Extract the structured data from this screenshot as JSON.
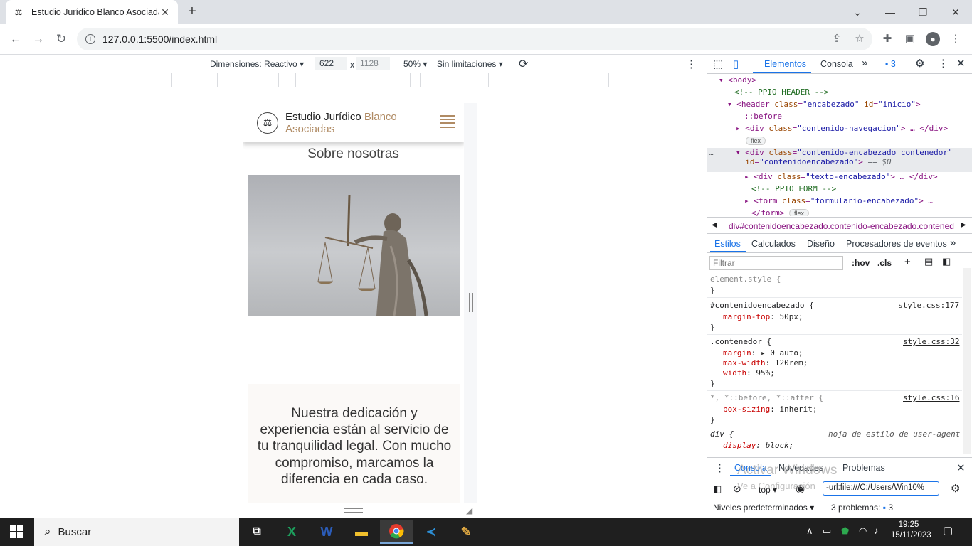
{
  "browser": {
    "tab_title": "Estudio Jurídico Blanco Asociadas",
    "favicon": "gavel-icon",
    "url": "127.0.0.1:5500/index.html"
  },
  "device_toolbar": {
    "dimensions_label": "Dimensiones: Reactivo",
    "width": "622",
    "x_sep": "x",
    "height": "1128",
    "zoom": "50%",
    "throttle": "Sin limitaciones"
  },
  "site": {
    "brand_main": "Estudio Jurídico",
    "brand_accent": "Blanco",
    "brand_line2": "Asociadas",
    "about_title": "Sobre nosotras",
    "photo_alt": "justice-statue-photo",
    "card_text": "Nuestra dedicación y experiencia están al servicio de tu tranquilidad legal. Con mucho compromiso, marcamos la diferencia en cada caso.",
    "accent_color": "#b08b64"
  },
  "devtools": {
    "tabs": [
      "Elementos",
      "Consola"
    ],
    "issues_count": "3",
    "dom": {
      "l1": "<body>",
      "l2": "<!-- PPIO HEADER -->",
      "l3_tag": "<header",
      "l3_a1": "class",
      "l3_v1": "\"encabezado\"",
      "l3_a2": "id",
      "l3_v2": "\"inicio\"",
      "l4": "::before",
      "l5_tag": "<div",
      "l5_a": "class",
      "l5_v": "\"contenido-navegacion\"",
      "l5_end": "</div>",
      "flex": "flex",
      "l6_tag": "<div",
      "l6_a": "class",
      "l6_v": "\"contenido-encabezado contenedor\"",
      "l7_a": "id",
      "l7_v": "\"contenidoencabezado\"",
      "l7_eq": "== $0",
      "l8_tag": "<div",
      "l8_a": "class",
      "l8_v": "\"texto-encabezado\"",
      "l8_end": "</div>",
      "l9": "<!-- PPIO FORM -->",
      "l10_tag": "<form",
      "l10_a": "class",
      "l10_v": "\"formulario-encabezado\"",
      "l11": "</form>"
    },
    "breadcrumb": "div#contenidoencabezado.contenido-encabezado.contened",
    "style_tabs": [
      "Estilos",
      "Calculados",
      "Diseño",
      "Procesadores de eventos"
    ],
    "filter_placeholder": "Filtrar",
    "hov": ":hov",
    "cls": ".cls",
    "rules": {
      "r1_sel": "element.style {",
      "close": "}",
      "r2_sel": "#contenidoencabezado {",
      "r2_src": "style.css:177",
      "r2_p": "margin-top",
      "r2_v": "50px;",
      "r3_sel": ".contenedor {",
      "r3_src": "style.css:32",
      "r3_p1": "margin",
      "r3_v1": "0 auto;",
      "r3_p2": "max-width",
      "r3_v2": "120rem;",
      "r3_p3": "width",
      "r3_v3": "95%;",
      "r4_sel": "*, *::before, *::after {",
      "r4_src": "style.css:16",
      "r4_p": "box-sizing",
      "r4_v": "inherit;",
      "r5_sel": "div {",
      "r5_src": "hoja de estilo de user-agent",
      "r5_p": "display",
      "r5_v": "block;"
    },
    "drawer": {
      "tabs": [
        "Consola",
        "Novedades",
        "Problemas"
      ],
      "context": "top",
      "scope": "-url:file:///C:/Users/Win10%",
      "levels": "Niveles predeterminados",
      "problems": "3 problemas:",
      "problems_count": "3"
    }
  },
  "watermark": {
    "line1": "Activar Windows",
    "line2": "Ve a Configuración"
  },
  "taskbar": {
    "search": "Buscar",
    "time": "19:25",
    "date": "15/11/2023"
  }
}
